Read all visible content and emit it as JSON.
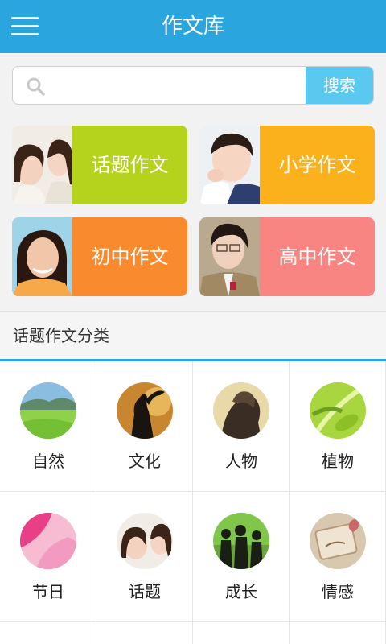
{
  "header": {
    "title": "作文库",
    "menu_icon": "menu-icon"
  },
  "search": {
    "placeholder": "",
    "value": "",
    "button_label": "搜索",
    "icon": "search-icon"
  },
  "cards": [
    {
      "label": "话题作文",
      "color": "#b5d31c"
    },
    {
      "label": "小学作文",
      "color": "#fbb11c"
    },
    {
      "label": "初中作文",
      "color": "#f98a2d"
    },
    {
      "label": "高中作文",
      "color": "#f98583"
    }
  ],
  "section": {
    "title": "话题作文分类",
    "accent": "#2aa5de"
  },
  "categories": [
    {
      "label": "自然"
    },
    {
      "label": "文化"
    },
    {
      "label": "人物"
    },
    {
      "label": "植物"
    },
    {
      "label": "节日"
    },
    {
      "label": "话题"
    },
    {
      "label": "成长"
    },
    {
      "label": "情感"
    }
  ]
}
